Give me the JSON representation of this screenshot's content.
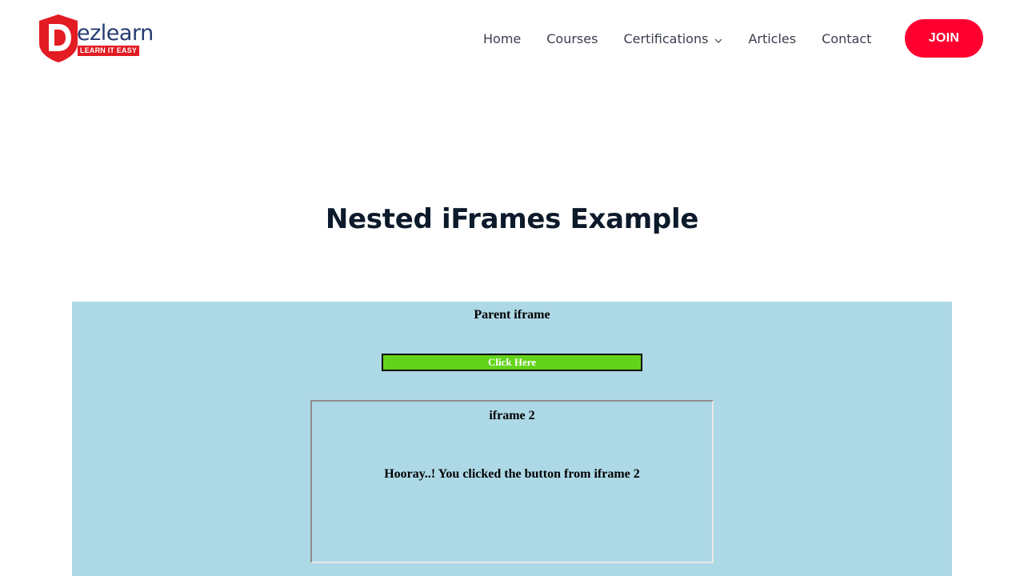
{
  "header": {
    "logo": {
      "letter": "D",
      "text": "ezlearn",
      "tagline": "LEARN IT EASY",
      "colors": {
        "shield": "#e31b23",
        "text": "#263b73"
      }
    },
    "nav": {
      "items": [
        {
          "label": "Home"
        },
        {
          "label": "Courses"
        },
        {
          "label": "Certifications",
          "icon": "chevron-down-icon"
        },
        {
          "label": "Articles"
        },
        {
          "label": "Contact"
        }
      ],
      "join_label": "JOIN",
      "join_color": "#fe0030"
    }
  },
  "main": {
    "title": "Nested iFrames Example",
    "parent_frame": {
      "heading": "Parent iframe",
      "button_label": "Click Here",
      "background": "#add8e6",
      "button_color": "#64d41b",
      "child_frame": {
        "heading": "iframe 2",
        "message": "Hooray..! You clicked the button from iframe 2"
      }
    }
  }
}
